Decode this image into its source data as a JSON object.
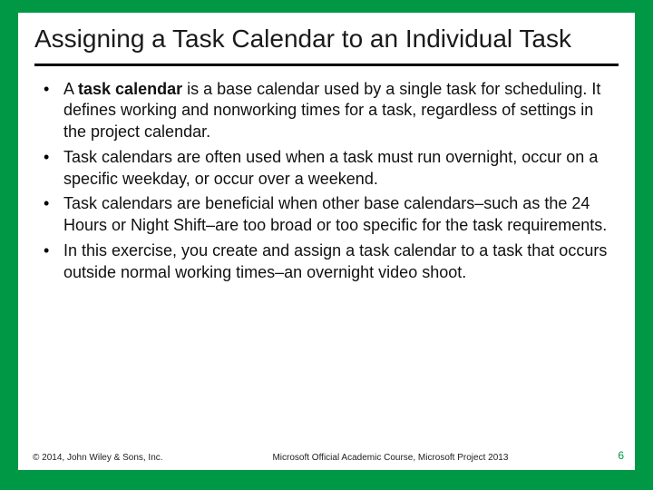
{
  "slide": {
    "title": "Assigning a Task Calendar to an Individual Task",
    "bullets": [
      {
        "pre": "A ",
        "term": "task calendar",
        "post": " is a base calendar used by a single task for scheduling. It defines working and nonworking times for a task, regardless of settings in the project calendar."
      },
      {
        "pre": "",
        "term": "",
        "post": "Task calendars are often used when a task must run overnight, occur on a specific weekday, or occur over a weekend."
      },
      {
        "pre": "",
        "term": "",
        "post": "Task calendars are beneficial when other base calendars–such as the 24 Hours or Night Shift–are too broad or too specific for the task requirements."
      },
      {
        "pre": "",
        "term": "",
        "post": "In this exercise, you create and assign a task calendar to a task that occurs outside normal working times–an overnight video shoot."
      }
    ]
  },
  "footer": {
    "copyright": "© 2014, John Wiley & Sons, Inc.",
    "course": "Microsoft Official Academic Course, Microsoft Project 2013",
    "page": "6"
  }
}
